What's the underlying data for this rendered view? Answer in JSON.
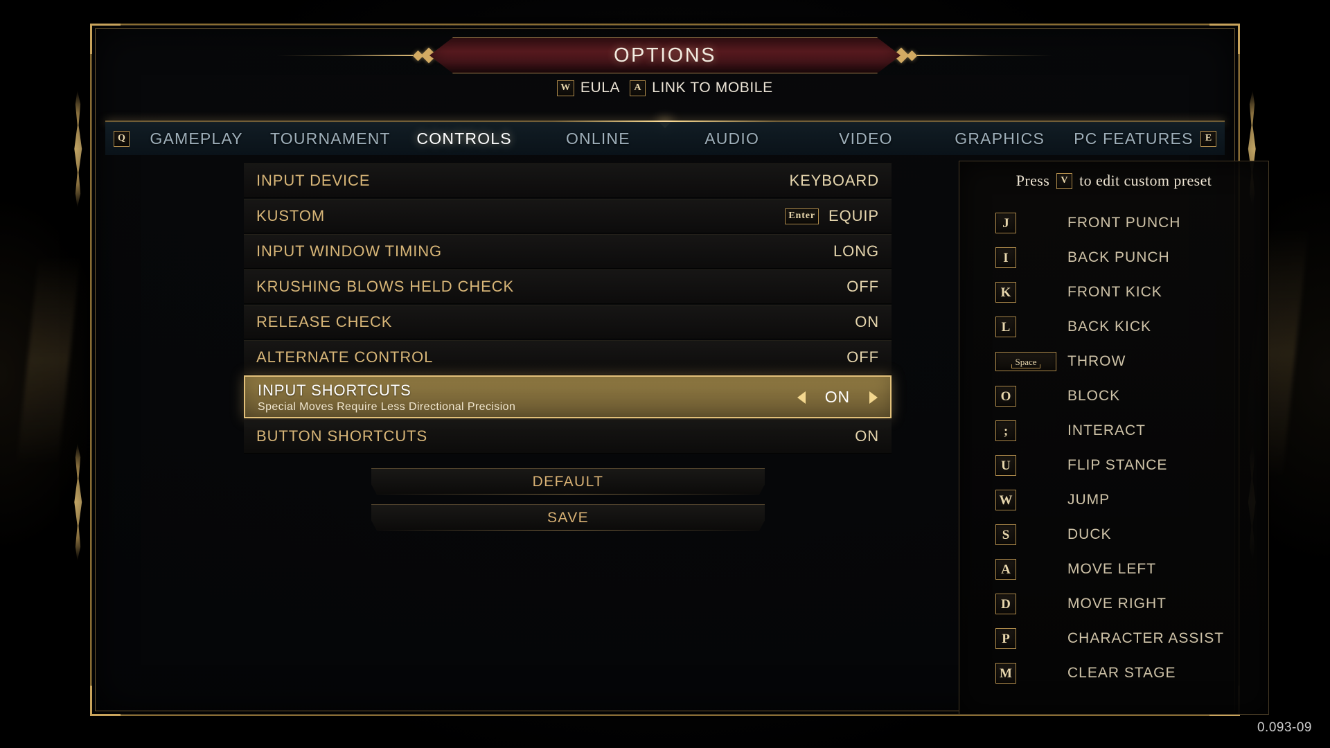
{
  "header": {
    "title": "OPTIONS",
    "sub_actions": [
      {
        "key": "W",
        "label": "EULA"
      },
      {
        "key": "A",
        "label": "LINK TO MOBILE"
      }
    ]
  },
  "tabs": {
    "left_badge": "Q",
    "right_badge": "E",
    "items": [
      {
        "label": "GAMEPLAY",
        "active": false
      },
      {
        "label": "TOURNAMENT",
        "active": false
      },
      {
        "label": "CONTROLS",
        "active": true
      },
      {
        "label": "ONLINE",
        "active": false
      },
      {
        "label": "AUDIO",
        "active": false
      },
      {
        "label": "VIDEO",
        "active": false
      },
      {
        "label": "GRAPHICS",
        "active": false
      },
      {
        "label": "PC FEATURES",
        "active": false
      }
    ]
  },
  "settings": [
    {
      "label": "INPUT DEVICE",
      "value": "KEYBOARD",
      "key": null,
      "selected": false,
      "sub": null
    },
    {
      "label": "KUSTOM",
      "value": "EQUIP",
      "key": "Enter",
      "selected": false,
      "sub": null
    },
    {
      "label": "INPUT WINDOW TIMING",
      "value": "LONG",
      "key": null,
      "selected": false,
      "sub": null
    },
    {
      "label": "KRUSHING BLOWS HELD CHECK",
      "value": "OFF",
      "key": null,
      "selected": false,
      "sub": null
    },
    {
      "label": "RELEASE CHECK",
      "value": "ON",
      "key": null,
      "selected": false,
      "sub": null
    },
    {
      "label": "ALTERNATE CONTROL",
      "value": "OFF",
      "key": null,
      "selected": false,
      "sub": null
    },
    {
      "label": "INPUT SHORTCUTS",
      "value": "ON",
      "key": null,
      "selected": true,
      "sub": "Special Moves Require Less Directional Precision"
    },
    {
      "label": "BUTTON SHORTCUTS",
      "value": "ON",
      "key": null,
      "selected": false,
      "sub": null
    }
  ],
  "buttons": [
    {
      "label": "DEFAULT"
    },
    {
      "label": "SAVE"
    }
  ],
  "preset": {
    "hint_prefix": "Press",
    "hint_key": "V",
    "hint_suffix": "to edit custom preset",
    "bindings": [
      {
        "key": "J",
        "action": "FRONT PUNCH",
        "wide": false
      },
      {
        "key": "I",
        "action": "BACK PUNCH",
        "wide": false
      },
      {
        "key": "K",
        "action": "FRONT KICK",
        "wide": false
      },
      {
        "key": "L",
        "action": "BACK KICK",
        "wide": false
      },
      {
        "key": "Space",
        "action": "THROW",
        "wide": true
      },
      {
        "key": "O",
        "action": "BLOCK",
        "wide": false
      },
      {
        "key": ";",
        "action": "INTERACT",
        "wide": false
      },
      {
        "key": "U",
        "action": "FLIP STANCE",
        "wide": false
      },
      {
        "key": "W",
        "action": "JUMP",
        "wide": false
      },
      {
        "key": "S",
        "action": "DUCK",
        "wide": false
      },
      {
        "key": "A",
        "action": "MOVE LEFT",
        "wide": false
      },
      {
        "key": "D",
        "action": "MOVE RIGHT",
        "wide": false
      },
      {
        "key": "P",
        "action": "CHARACTER ASSIST",
        "wide": false
      },
      {
        "key": "M",
        "action": "CLEAR STAGE",
        "wide": false
      }
    ]
  },
  "version": "0.093-09",
  "colors": {
    "gold": "#c9a45c",
    "gold_light": "#e8d7ad",
    "label_gold": "#d8b678",
    "banner_red": "#5b1b20",
    "tab_inactive": "#9fb0bb",
    "selected_bg": "#806c3b"
  }
}
